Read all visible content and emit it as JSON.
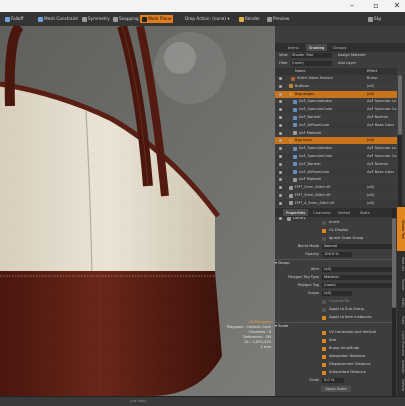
{
  "toolbar": {
    "items": [
      {
        "label": "Falloff",
        "icon_color": "#6fa3d8",
        "active": false
      },
      {
        "label": "Mesh Constraint",
        "icon_color": "#6fa3d8",
        "active": false
      },
      {
        "label": "Symmetry",
        "icon_color": "#9a9a9a",
        "active": false
      },
      {
        "label": "Snapping",
        "icon_color": "#9a9a9a",
        "active": false
      },
      {
        "label": "Work Plane",
        "icon_color": "#222222",
        "active": true
      },
      {
        "label": "Drop Action: (none)",
        "icon_color": "#9a9a9a",
        "active": false
      },
      {
        "label": "Render",
        "icon_color": "#e0b040",
        "active": false
      },
      {
        "label": "Preview",
        "icon_color": "#9a9a9a",
        "active": false
      }
    ],
    "sky_label": "Sky"
  },
  "panel": {
    "top_tabs": [
      "Items",
      "Shading",
      "Groups"
    ],
    "view_label": "View",
    "view_value": "Shader Tree",
    "assign_label": "Assign Material",
    "filter_label": "Filter",
    "filter_value": "(none)",
    "add_layer_label": "Add Layer",
    "col_name": "Name",
    "col_effect": "Effect",
    "layers": [
      {
        "name": "Stitch Holes Texture",
        "effect": "Bump",
        "color": "#b06030",
        "indent": 6,
        "selected": false
      },
      {
        "name": "Buttons",
        "effect": "(all)",
        "color": "#c08830",
        "indent": 4,
        "selected": false
      },
      {
        "name": "Bag edges",
        "effect": "(all)",
        "color": "#d08830",
        "indent": 4,
        "selected": true
      },
      {
        "name": "AxF_SpecularLobe",
        "effect": "AxF Specular Lo...",
        "color": "#6a8fbf",
        "indent": 8,
        "selected": false
      },
      {
        "name": "AxF_SpecularColor",
        "effect": "AxF Specular Co...",
        "color": "#6a8fbf",
        "indent": 8,
        "selected": false
      },
      {
        "name": "AxF_Normal",
        "effect": "AxF Normal",
        "color": "#6a8fbf",
        "indent": 8,
        "selected": false
      },
      {
        "name": "AxF_DiffuseColor",
        "effect": "AxF Base Color",
        "color": "#6a8fbf",
        "indent": 8,
        "selected": false
      },
      {
        "name": "AxF Material",
        "effect": "",
        "color": "#9a9a9a",
        "indent": 8,
        "selected": false
      },
      {
        "name": "Bag base",
        "effect": "(all)",
        "color": "#d08830",
        "indent": 4,
        "selected": true
      },
      {
        "name": "AxF_SpecularLobe",
        "effect": "AxF Specular Lo...",
        "color": "#6a8fbf",
        "indent": 8,
        "selected": false
      },
      {
        "name": "AxF_SpecularColor",
        "effect": "AxF Specular Co...",
        "color": "#6a8fbf",
        "indent": 8,
        "selected": false
      },
      {
        "name": "AxF_Normal",
        "effect": "AxF Normal",
        "color": "#6a8fbf",
        "indent": 8,
        "selected": false
      },
      {
        "name": "AxF_DiffuseColor",
        "effect": "AxF Base Color",
        "color": "#6a8fbf",
        "indent": 8,
        "selected": false
      },
      {
        "name": "AxF Material",
        "effect": "",
        "color": "#9a9a9a",
        "indent": 8,
        "selected": false
      },
      {
        "name": "FMT_2mm_Stitch.tif",
        "effect": "(all)",
        "color": "#9a9a9a",
        "indent": 4,
        "selected": false
      },
      {
        "name": "FMT_3mm_Stitch.tif",
        "effect": "(all)",
        "color": "#9a9a9a",
        "indent": 4,
        "selected": false
      },
      {
        "name": "FMT_4_5mm_Stitch.tif",
        "effect": "(all)",
        "color": "#9a9a9a",
        "indent": 4,
        "selected": false
      },
      {
        "name": "Base Material",
        "effect": "(all)",
        "color": "#9a9a9a",
        "indent": 4,
        "selected": false
      },
      {
        "name": "Library",
        "effect": "",
        "color": "#9a9a9a",
        "indent": 2,
        "selected": false
      }
    ],
    "prop_tabs": [
      "Properties",
      "Channels",
      "Vertex",
      "Stats"
    ],
    "props": {
      "invert": "Invert",
      "gl_display": "GL Display",
      "ignore_scale": "Ignore Scale Group",
      "blend_mode_label": "Blend Mode",
      "blend_mode_value": "Normal",
      "opacity_label": "Opacity",
      "opacity_value": "100.0 %",
      "group_section": "Group",
      "item_label": "Item",
      "item_value": "(all)",
      "polytag_type_label": "Polygon Tag Type",
      "polytag_type_value": "Material",
      "polytag_label": "Polygon Tag",
      "polytag_value": "(none)",
      "scope_label": "Scope",
      "scope_value": "(all)",
      "layered_fix": "Layered Fix",
      "apply_sub": "Apply to Sub Group",
      "apply_instances": "Apply to Item Instances",
      "scale_section": "Scale",
      "uv_hv": "UV Horizontal and Vertical",
      "size": "Size",
      "bump_amp": "Bump Amplitude",
      "absorption": "Absorption Distance",
      "displacement": "Displacement Distance",
      "subsurface": "Subsurface Distance",
      "scale_label": "Scale",
      "scale_value": "5.0 %",
      "apply_scale": "Apply Scale"
    },
    "side_tabs": [
      "Shader Tree",
      "Item List",
      "Render",
      "Utility",
      "Paint",
      "Layer Overview",
      "Animate",
      "Deform"
    ]
  },
  "viewport": {
    "mode_title": "All Polygons",
    "polygons_label": "Polygons : Catmull-Clark",
    "channels_label": "Channels : 0",
    "deformers_label": "Deformers : ON",
    "gl_label": "GL : 1,893,420",
    "unit_label": "1 mm",
    "help_text": "(no info)"
  },
  "colors": {
    "accent": "#e2861f",
    "leather_brown": "#5a1e14",
    "leather_cream": "#e4dccb"
  }
}
